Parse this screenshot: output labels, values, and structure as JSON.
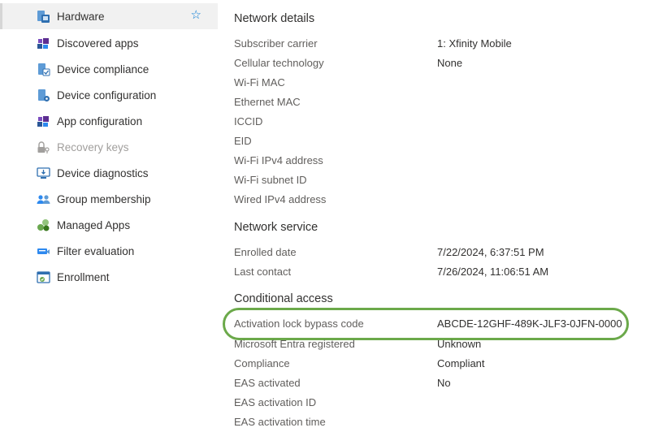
{
  "sidebar": {
    "items": [
      {
        "label": "Hardware",
        "icon": "hardware-icon",
        "selected": true,
        "favorite_icon": "star-outline-icon"
      },
      {
        "label": "Discovered apps",
        "icon": "apps-icon"
      },
      {
        "label": "Device compliance",
        "icon": "device-compliance-icon"
      },
      {
        "label": "Device configuration",
        "icon": "device-configuration-icon"
      },
      {
        "label": "App configuration",
        "icon": "app-configuration-icon"
      },
      {
        "label": "Recovery keys",
        "icon": "lock-key-icon",
        "disabled": true
      },
      {
        "label": "Device diagnostics",
        "icon": "diagnostics-icon"
      },
      {
        "label": "Group membership",
        "icon": "group-icon"
      },
      {
        "label": "Managed Apps",
        "icon": "managed-apps-icon"
      },
      {
        "label": "Filter evaluation",
        "icon": "filter-icon"
      },
      {
        "label": "Enrollment",
        "icon": "enrollment-icon"
      }
    ]
  },
  "network_details": {
    "title": "Network details",
    "rows": [
      {
        "label": "Subscriber carrier",
        "value": "1: Xfinity Mobile"
      },
      {
        "label": "Cellular technology",
        "value": "None"
      },
      {
        "label": "Wi-Fi MAC",
        "value": ""
      },
      {
        "label": "Ethernet MAC",
        "value": ""
      },
      {
        "label": "ICCID",
        "value": ""
      },
      {
        "label": "EID",
        "value": ""
      },
      {
        "label": "Wi-Fi IPv4 address",
        "value": ""
      },
      {
        "label": "Wi-Fi subnet ID",
        "value": ""
      },
      {
        "label": "Wired IPv4 address",
        "value": ""
      }
    ]
  },
  "network_service": {
    "title": "Network service",
    "rows": [
      {
        "label": "Enrolled date",
        "value": "7/22/2024, 6:37:51 PM"
      },
      {
        "label": "Last contact",
        "value": "7/26/2024, 11:06:51 AM"
      }
    ]
  },
  "conditional_access": {
    "title": "Conditional access",
    "rows": [
      {
        "label": "Activation lock bypass code",
        "value": "ABCDE-12GHF-489K-JLF3-0JFN-0000"
      },
      {
        "label": "Microsoft Entra registered",
        "value": "Unknown"
      },
      {
        "label": "Compliance",
        "value": "Compliant"
      },
      {
        "label": "EAS activated",
        "value": "No"
      },
      {
        "label": "EAS activation ID",
        "value": ""
      },
      {
        "label": "EAS activation time",
        "value": ""
      }
    ]
  },
  "colors": {
    "highlight": "#6ba94a",
    "accent": "#0078d4"
  }
}
